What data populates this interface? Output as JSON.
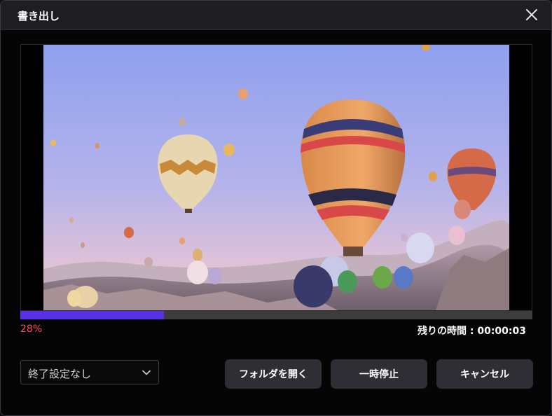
{
  "dialog": {
    "title": "書き出し",
    "close_icon": "close-icon"
  },
  "progress": {
    "percent_text": "28%",
    "fraction": 0.28,
    "remaining_text": "残りの時間 : 00:00:03",
    "fill_color": "#5a32e6",
    "percent_color": "#ff4d5a"
  },
  "after_export": {
    "selected": "終了設定なし",
    "chevron_icon": "chevron-down-icon"
  },
  "buttons": {
    "open_folder": "フォルダを開く",
    "pause": "一時停止",
    "cancel": "キャンセル"
  }
}
